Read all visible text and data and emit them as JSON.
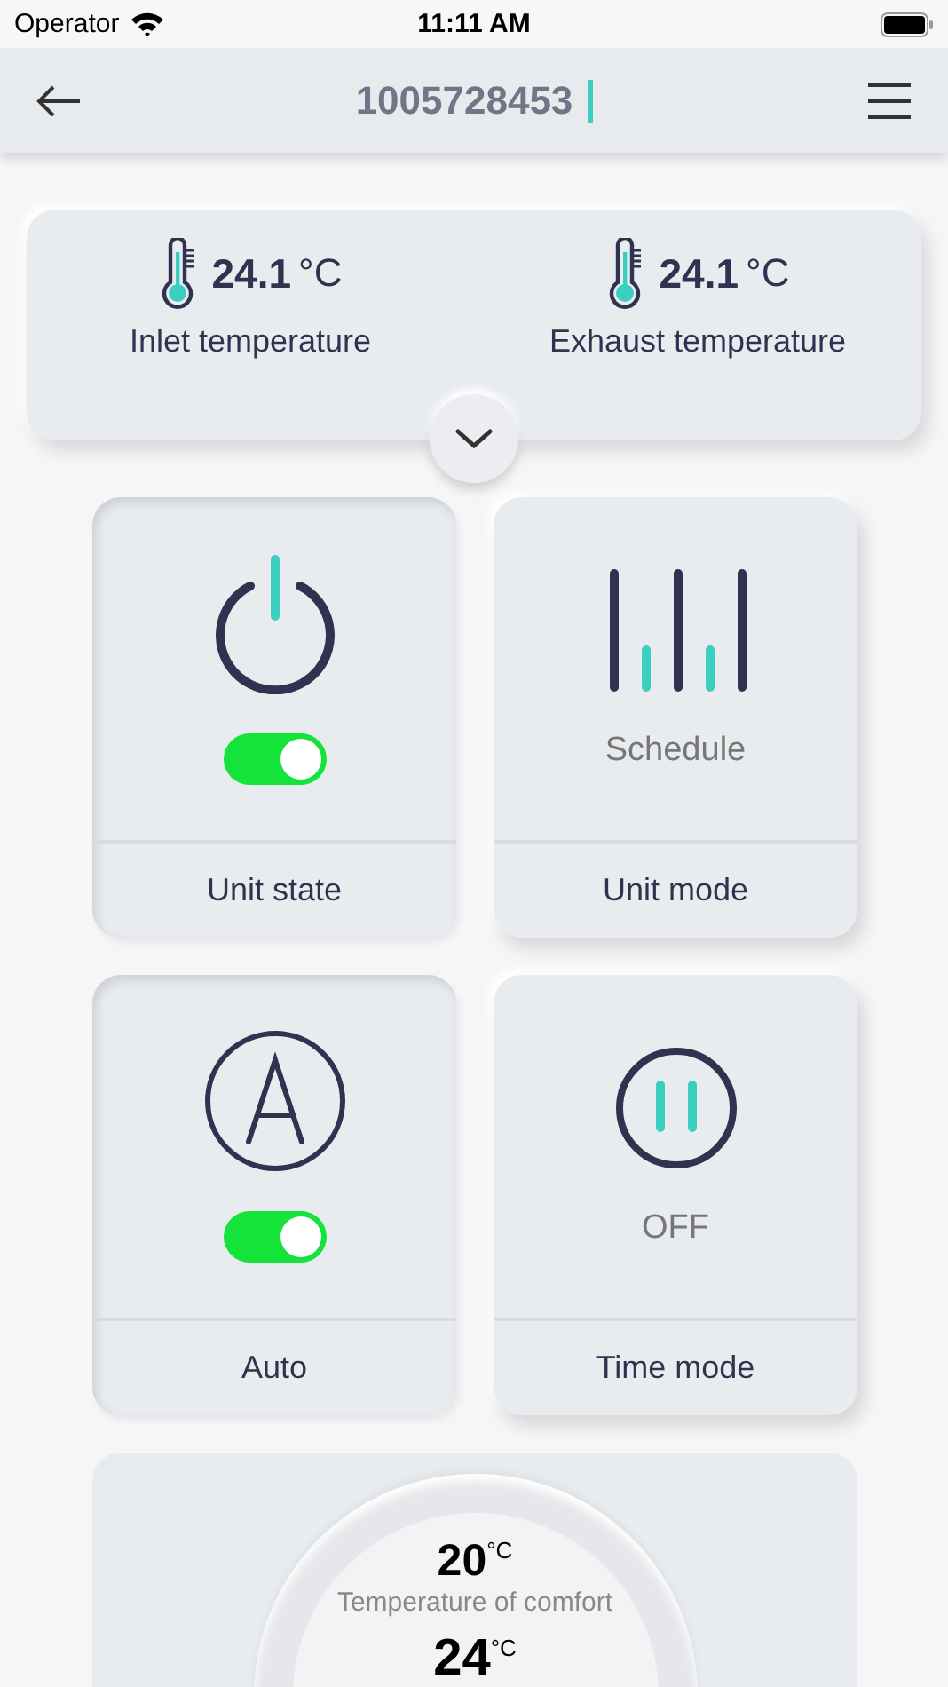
{
  "status_bar": {
    "carrier": "Operator",
    "time": "11:11 AM"
  },
  "header": {
    "title": "1005728453"
  },
  "temperatures": [
    {
      "value": "24.1",
      "unit": "°C",
      "label": "Inlet temperature"
    },
    {
      "value": "24.1",
      "unit": "°C",
      "label": "Exhaust temperature"
    }
  ],
  "tiles": [
    {
      "kind": "power",
      "label": "Unit state",
      "on": true
    },
    {
      "kind": "schedule",
      "label": "Unit mode",
      "value": "Schedule"
    },
    {
      "kind": "auto",
      "label": "Auto",
      "on": true
    },
    {
      "kind": "timer",
      "label": "Time mode",
      "value": "OFF"
    }
  ],
  "comfort": {
    "setpoint": "20$^{°C}$",
    "label": "Temperature of comfort",
    "current": "24$^{°C}$"
  }
}
